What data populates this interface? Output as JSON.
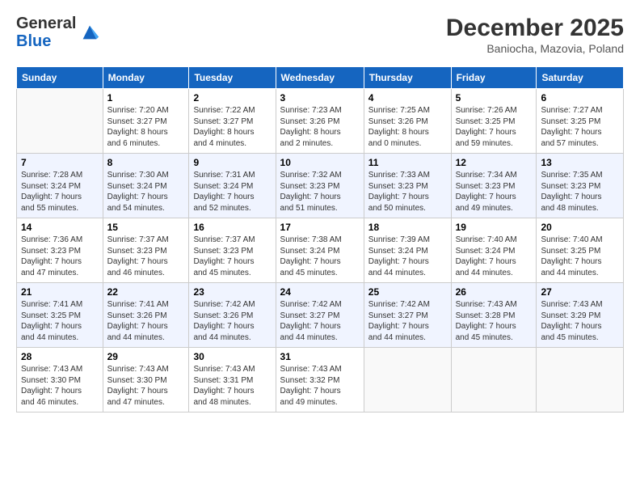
{
  "header": {
    "logo_general": "General",
    "logo_blue": "Blue",
    "month_title": "December 2025",
    "subtitle": "Baniocha, Mazovia, Poland"
  },
  "weekdays": [
    "Sunday",
    "Monday",
    "Tuesday",
    "Wednesday",
    "Thursday",
    "Friday",
    "Saturday"
  ],
  "weeks": [
    [
      {
        "day": "",
        "info": ""
      },
      {
        "day": "1",
        "info": "Sunrise: 7:20 AM\nSunset: 3:27 PM\nDaylight: 8 hours\nand 6 minutes."
      },
      {
        "day": "2",
        "info": "Sunrise: 7:22 AM\nSunset: 3:27 PM\nDaylight: 8 hours\nand 4 minutes."
      },
      {
        "day": "3",
        "info": "Sunrise: 7:23 AM\nSunset: 3:26 PM\nDaylight: 8 hours\nand 2 minutes."
      },
      {
        "day": "4",
        "info": "Sunrise: 7:25 AM\nSunset: 3:26 PM\nDaylight: 8 hours\nand 0 minutes."
      },
      {
        "day": "5",
        "info": "Sunrise: 7:26 AM\nSunset: 3:25 PM\nDaylight: 7 hours\nand 59 minutes."
      },
      {
        "day": "6",
        "info": "Sunrise: 7:27 AM\nSunset: 3:25 PM\nDaylight: 7 hours\nand 57 minutes."
      }
    ],
    [
      {
        "day": "7",
        "info": "Sunrise: 7:28 AM\nSunset: 3:24 PM\nDaylight: 7 hours\nand 55 minutes."
      },
      {
        "day": "8",
        "info": "Sunrise: 7:30 AM\nSunset: 3:24 PM\nDaylight: 7 hours\nand 54 minutes."
      },
      {
        "day": "9",
        "info": "Sunrise: 7:31 AM\nSunset: 3:24 PM\nDaylight: 7 hours\nand 52 minutes."
      },
      {
        "day": "10",
        "info": "Sunrise: 7:32 AM\nSunset: 3:23 PM\nDaylight: 7 hours\nand 51 minutes."
      },
      {
        "day": "11",
        "info": "Sunrise: 7:33 AM\nSunset: 3:23 PM\nDaylight: 7 hours\nand 50 minutes."
      },
      {
        "day": "12",
        "info": "Sunrise: 7:34 AM\nSunset: 3:23 PM\nDaylight: 7 hours\nand 49 minutes."
      },
      {
        "day": "13",
        "info": "Sunrise: 7:35 AM\nSunset: 3:23 PM\nDaylight: 7 hours\nand 48 minutes."
      }
    ],
    [
      {
        "day": "14",
        "info": "Sunrise: 7:36 AM\nSunset: 3:23 PM\nDaylight: 7 hours\nand 47 minutes."
      },
      {
        "day": "15",
        "info": "Sunrise: 7:37 AM\nSunset: 3:23 PM\nDaylight: 7 hours\nand 46 minutes."
      },
      {
        "day": "16",
        "info": "Sunrise: 7:37 AM\nSunset: 3:23 PM\nDaylight: 7 hours\nand 45 minutes."
      },
      {
        "day": "17",
        "info": "Sunrise: 7:38 AM\nSunset: 3:24 PM\nDaylight: 7 hours\nand 45 minutes."
      },
      {
        "day": "18",
        "info": "Sunrise: 7:39 AM\nSunset: 3:24 PM\nDaylight: 7 hours\nand 44 minutes."
      },
      {
        "day": "19",
        "info": "Sunrise: 7:40 AM\nSunset: 3:24 PM\nDaylight: 7 hours\nand 44 minutes."
      },
      {
        "day": "20",
        "info": "Sunrise: 7:40 AM\nSunset: 3:25 PM\nDaylight: 7 hours\nand 44 minutes."
      }
    ],
    [
      {
        "day": "21",
        "info": "Sunrise: 7:41 AM\nSunset: 3:25 PM\nDaylight: 7 hours\nand 44 minutes."
      },
      {
        "day": "22",
        "info": "Sunrise: 7:41 AM\nSunset: 3:26 PM\nDaylight: 7 hours\nand 44 minutes."
      },
      {
        "day": "23",
        "info": "Sunrise: 7:42 AM\nSunset: 3:26 PM\nDaylight: 7 hours\nand 44 minutes."
      },
      {
        "day": "24",
        "info": "Sunrise: 7:42 AM\nSunset: 3:27 PM\nDaylight: 7 hours\nand 44 minutes."
      },
      {
        "day": "25",
        "info": "Sunrise: 7:42 AM\nSunset: 3:27 PM\nDaylight: 7 hours\nand 44 minutes."
      },
      {
        "day": "26",
        "info": "Sunrise: 7:43 AM\nSunset: 3:28 PM\nDaylight: 7 hours\nand 45 minutes."
      },
      {
        "day": "27",
        "info": "Sunrise: 7:43 AM\nSunset: 3:29 PM\nDaylight: 7 hours\nand 45 minutes."
      }
    ],
    [
      {
        "day": "28",
        "info": "Sunrise: 7:43 AM\nSunset: 3:30 PM\nDaylight: 7 hours\nand 46 minutes."
      },
      {
        "day": "29",
        "info": "Sunrise: 7:43 AM\nSunset: 3:30 PM\nDaylight: 7 hours\nand 47 minutes."
      },
      {
        "day": "30",
        "info": "Sunrise: 7:43 AM\nSunset: 3:31 PM\nDaylight: 7 hours\nand 48 minutes."
      },
      {
        "day": "31",
        "info": "Sunrise: 7:43 AM\nSunset: 3:32 PM\nDaylight: 7 hours\nand 49 minutes."
      },
      {
        "day": "",
        "info": ""
      },
      {
        "day": "",
        "info": ""
      },
      {
        "day": "",
        "info": ""
      }
    ]
  ]
}
